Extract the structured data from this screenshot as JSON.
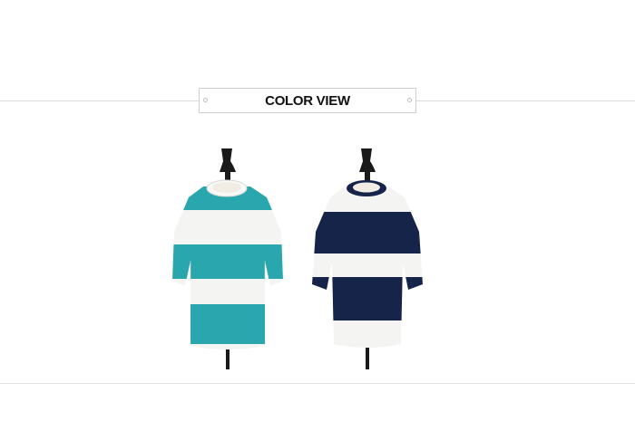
{
  "section": {
    "title": "COLOR VIEW"
  },
  "products": [
    {
      "name": "teal-white-stripe-knit",
      "stripe_color": "#2aa6ae",
      "base_color": "#f4f4f2"
    },
    {
      "name": "navy-white-stripe-knit",
      "stripe_color": "#16244a",
      "base_color": "#f4f4f2"
    }
  ]
}
